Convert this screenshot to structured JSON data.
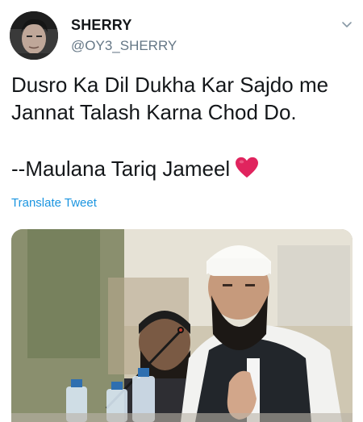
{
  "user": {
    "display_name": "SHERRY",
    "handle": "@OY3_SHERRY",
    "avatar_icon": "avatar-photo"
  },
  "tweet": {
    "lines": [
      "Dusro Ka Dil Dukha Kar Sajdo me",
      "Jannat Talash Karna Chod Do.",
      "--Maulana Tariq Jameel"
    ],
    "emoji": "heart-emoji",
    "translate_label": "Translate Tweet"
  },
  "media": {
    "type": "photo"
  },
  "colors": {
    "name": "#14171a",
    "secondary": "#657786",
    "link": "#1b95e0",
    "heart": "#e0245e"
  }
}
